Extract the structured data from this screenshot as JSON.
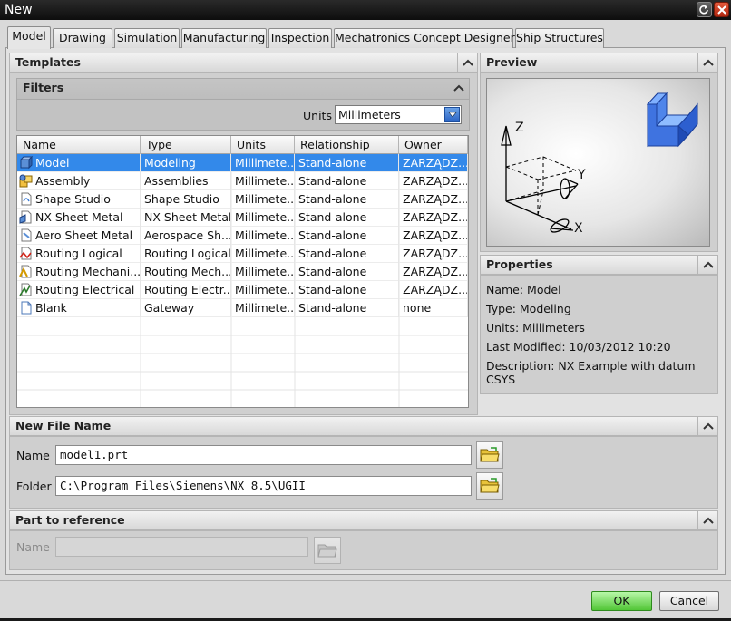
{
  "window": {
    "title": "New"
  },
  "tabs": [
    "Model",
    "Drawing",
    "Simulation",
    "Manufacturing",
    "Inspection",
    "Mechatronics Concept Designer",
    "Ship Structures"
  ],
  "templates": {
    "header": "Templates",
    "filters": {
      "header": "Filters",
      "units_label": "Units",
      "units_value": "Millimeters"
    },
    "columns": [
      "Name",
      "Type",
      "Units",
      "Relationship",
      "Owner"
    ],
    "rows": [
      {
        "name": "Model",
        "type": "Modeling",
        "units": "Millimete...",
        "relationship": "Stand-alone",
        "owner": "ZARZĄDZ...",
        "icon": "model-icon"
      },
      {
        "name": "Assembly",
        "type": "Assemblies",
        "units": "Millimete...",
        "relationship": "Stand-alone",
        "owner": "ZARZĄDZ...",
        "icon": "assembly-icon"
      },
      {
        "name": "Shape Studio",
        "type": "Shape Studio",
        "units": "Millimete...",
        "relationship": "Stand-alone",
        "owner": "ZARZĄDZ...",
        "icon": "shape-studio-icon"
      },
      {
        "name": "NX Sheet Metal",
        "type": "NX Sheet Metal",
        "units": "Millimete...",
        "relationship": "Stand-alone",
        "owner": "ZARZĄDZ...",
        "icon": "sheet-metal-icon"
      },
      {
        "name": "Aero Sheet Metal",
        "type": "Aerospace Sh...",
        "units": "Millimete...",
        "relationship": "Stand-alone",
        "owner": "ZARZĄDZ...",
        "icon": "aero-sheet-metal-icon"
      },
      {
        "name": "Routing Logical",
        "type": "Routing Logical",
        "units": "Millimete...",
        "relationship": "Stand-alone",
        "owner": "ZARZĄDZ...",
        "icon": "routing-logical-icon"
      },
      {
        "name": "Routing Mechani...",
        "type": "Routing Mech...",
        "units": "Millimete...",
        "relationship": "Stand-alone",
        "owner": "ZARZĄDZ...",
        "icon": "routing-mechanical-icon"
      },
      {
        "name": "Routing Electrical",
        "type": "Routing Electr...",
        "units": "Millimete...",
        "relationship": "Stand-alone",
        "owner": "ZARZĄDZ...",
        "icon": "routing-electrical-icon"
      },
      {
        "name": "Blank",
        "type": "Gateway",
        "units": "Millimete...",
        "relationship": "Stand-alone",
        "owner": "none",
        "icon": "blank-document-icon"
      }
    ]
  },
  "preview": {
    "header": "Preview",
    "axis_x": "X",
    "axis_y": "Y",
    "axis_z": "Z"
  },
  "properties": {
    "header": "Properties",
    "name": "Name: Model",
    "type": "Type: Modeling",
    "units": "Units: Millimeters",
    "last_modified": "Last Modified: 10/03/2012 10:20",
    "description_line1": "Description: NX Example with datum",
    "description_line2": "CSYS"
  },
  "new_file": {
    "header": "New File Name",
    "name_label": "Name",
    "name_value": "model1.prt",
    "folder_label": "Folder",
    "folder_value": "C:\\Program Files\\Siemens\\NX 8.5\\UGII"
  },
  "part_ref": {
    "header": "Part to reference",
    "name_label": "Name",
    "name_value": ""
  },
  "buttons": {
    "ok": "OK",
    "cancel": "Cancel"
  },
  "colors": {
    "selection": "#3389ea",
    "ok_button": "#52c637",
    "close_button": "#c73a1f"
  }
}
